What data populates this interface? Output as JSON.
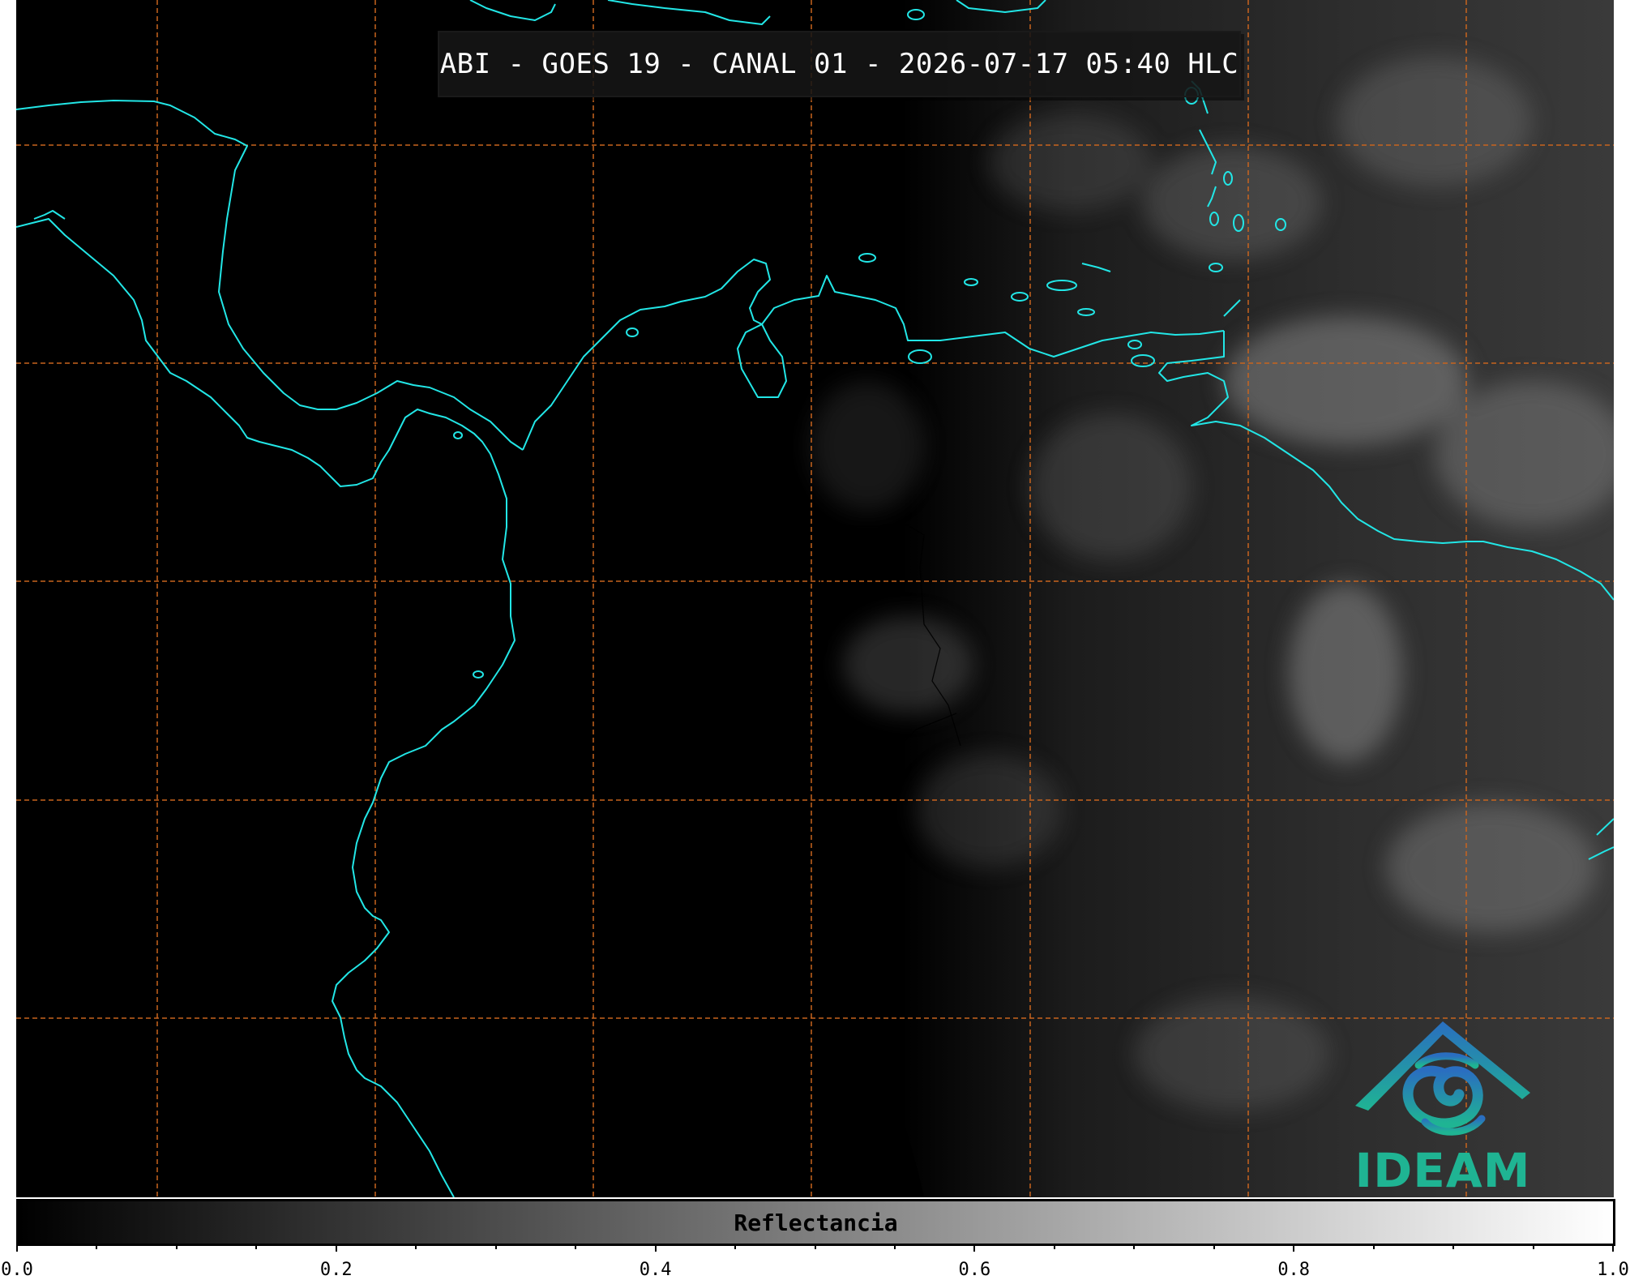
{
  "title": "ABI - GOES 19 - CANAL 01 - 2026-07-17 05:40 HLC",
  "colorbar": {
    "label": "Reflectancia",
    "min": 0.0,
    "max": 1.0,
    "gradient": [
      "#000000",
      "#ffffff"
    ],
    "major_ticks": [
      "0.0",
      "0.2",
      "0.4",
      "0.6",
      "0.8",
      "1.0"
    ],
    "minor_step": 0.05
  },
  "logo": {
    "text": "IDEAM",
    "color_top": "#2a6ec0",
    "color_bottom": "#1fb493"
  },
  "map": {
    "coastline_color": "#22e6e6",
    "border_color": "#000000",
    "grid_color": "#c8641e",
    "grid_style": "dashed",
    "terminator_side": "left-dark"
  }
}
